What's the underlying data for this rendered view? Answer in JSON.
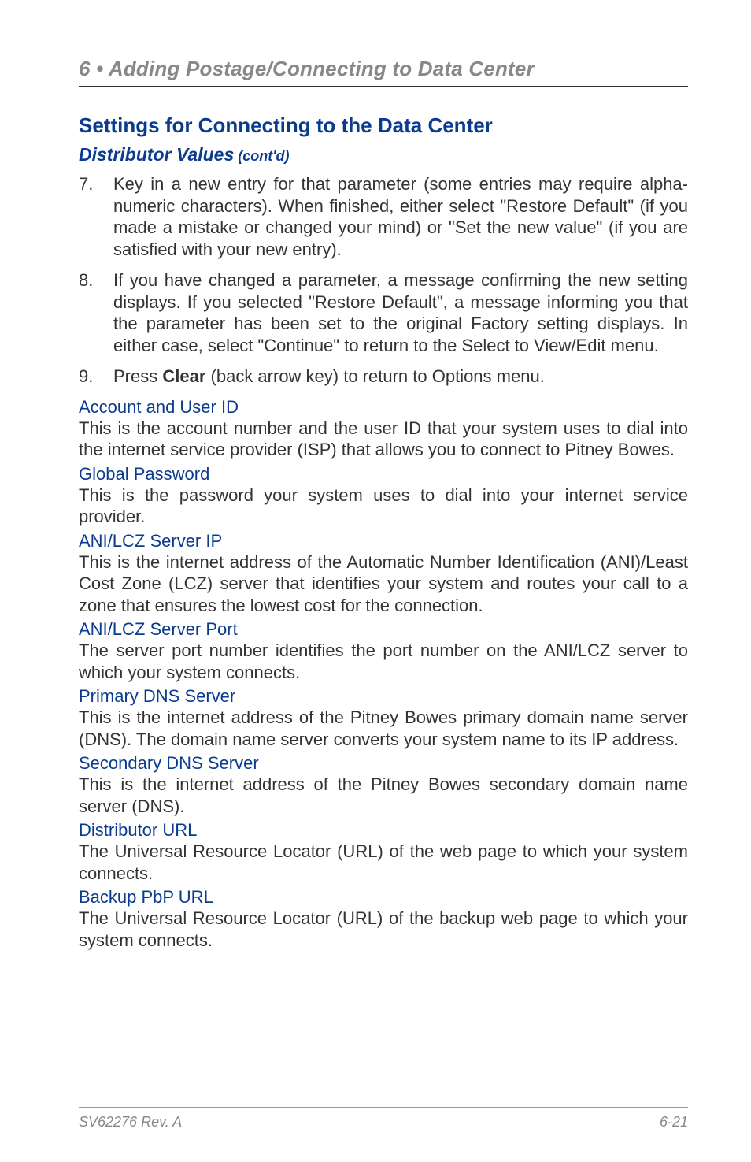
{
  "header": {
    "chapter_title": "6 • Adding Postage/Connecting to Data Center"
  },
  "section": {
    "title": "Settings for Connecting to the Data Center",
    "subsection": "Distributor Values",
    "contd": " (cont'd)"
  },
  "steps": [
    {
      "num": "7.",
      "text": "Key in a new entry for that parameter (some entries may require alpha-numeric characters). When finished, either select \"Restore Default\" (if you made a mistake or changed your mind) or \"Set the new value\" (if you are satisfied with your new entry)."
    },
    {
      "num": "8.",
      "text": "If you have changed a parameter, a message confirming the new setting displays. If you selected \"Restore Default\", a message informing you that the parameter has been set to the original Factory setting displays. In either case, select \"Continue\" to return to the Select to View/Edit menu."
    },
    {
      "num": "9.",
      "text_pre": "Press ",
      "text_bold": "Clear",
      "text_post": " (back arrow key) to return to Options menu."
    }
  ],
  "definitions": [
    {
      "heading": "Account and User ID",
      "body": "This is the account number and the user ID that your system uses to dial into the internet service provider (ISP) that allows you to connect to Pitney Bowes."
    },
    {
      "heading": "Global Password",
      "body": "This is the password your system uses to dial into your internet service provider."
    },
    {
      "heading": "ANI/LCZ Server IP",
      "body": "This is the internet address of the Automatic Number Identification (ANI)/Least Cost Zone (LCZ) server that identifies your system and routes your call to a zone that ensures the lowest cost for the connection."
    },
    {
      "heading": "ANI/LCZ Server Port",
      "body": "The server port number identifies the port number on the ANI/LCZ server to which your system connects."
    },
    {
      "heading": "Primary DNS Server",
      "body": "This is the internet address of the Pitney Bowes primary domain name server (DNS). The domain name server converts your system name to its IP address."
    },
    {
      "heading": "Secondary DNS Server",
      "body": "This is the internet address of the Pitney Bowes secondary domain name server (DNS)."
    },
    {
      "heading": "Distributor URL",
      "body": "The Universal Resource Locator (URL) of the web page to which your system connects."
    },
    {
      "heading": "Backup PbP URL",
      "body": "The Universal Resource Locator (URL) of the backup web page to which your system connects."
    }
  ],
  "footer": {
    "doc_ref": "SV62276 Rev. A",
    "page_num": "6-21"
  }
}
